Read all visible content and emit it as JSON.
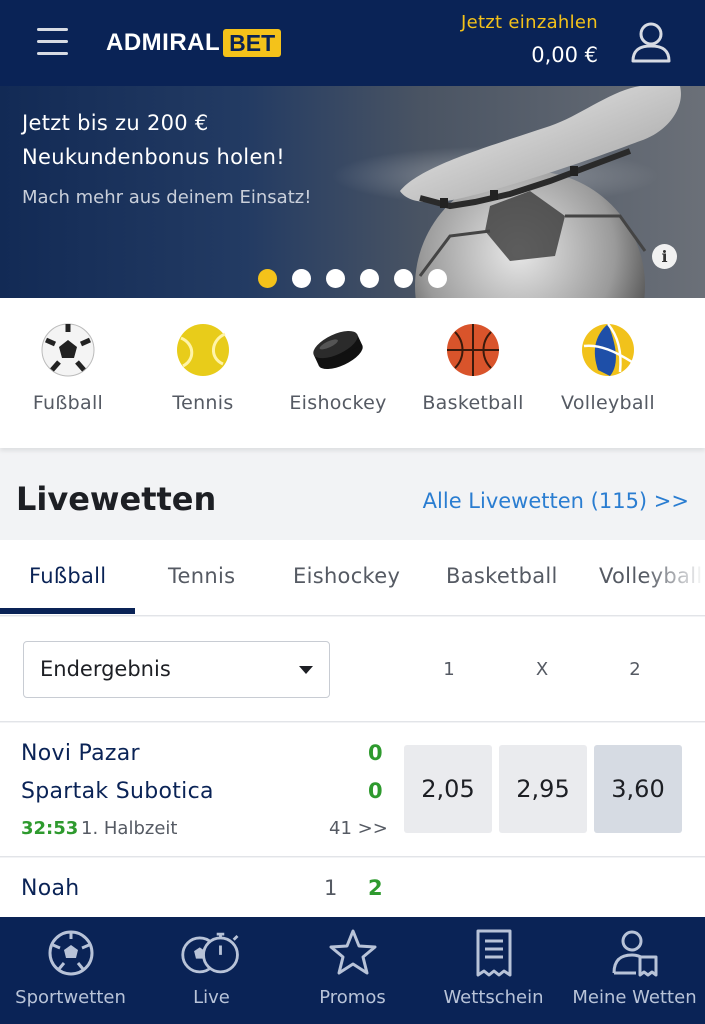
{
  "header": {
    "logo_left": "ADMIRAL",
    "logo_right": "BET",
    "deposit_label": "Jetzt einzahlen",
    "balance": "0,00 €"
  },
  "banner": {
    "headline_line1": "Jetzt bis zu 200 €",
    "headline_line2": "Neukundenbonus holen!",
    "subline": "Mach mehr aus deinem Einsatz!",
    "info_symbol": "i",
    "slides_total": 6,
    "active_slide": 1
  },
  "sports": [
    {
      "name": "Fußball",
      "icon": "soccer-ball-icon"
    },
    {
      "name": "Tennis",
      "icon": "tennis-ball-icon"
    },
    {
      "name": "Eishockey",
      "icon": "hockey-puck-icon"
    },
    {
      "name": "Basketball",
      "icon": "basketball-icon"
    },
    {
      "name": "Volleyball",
      "icon": "volleyball-icon"
    }
  ],
  "livewetten": {
    "title": "Livewetten",
    "all_link": "Alle Livewetten (115) >>",
    "tabs": [
      "Fußball",
      "Tennis",
      "Eishockey",
      "Basketball",
      "Volleyball"
    ],
    "active_tab": "Fußball",
    "market_select": "Endergebnis",
    "col_1": "1",
    "col_x": "X",
    "col_2": "2"
  },
  "matches": [
    {
      "home": "Novi Pazar",
      "away": "Spartak Subotica",
      "home_score": "0",
      "away_score": "0",
      "clock": "32:53",
      "period": "1. Halbzeit",
      "more_markets": "41 >>",
      "odds": [
        "2,05",
        "2,95",
        "3,60"
      ]
    },
    {
      "home": "Noah",
      "set_count": "1",
      "home_score": "2"
    }
  ],
  "bottom_nav": [
    {
      "label": "Sportwetten",
      "icon": "soccer-ball-icon"
    },
    {
      "label": "Live",
      "icon": "stopwatch-icon"
    },
    {
      "label": "Promos",
      "icon": "star-icon"
    },
    {
      "label": "Wettschein",
      "icon": "receipt-icon"
    },
    {
      "label": "Meine Wetten",
      "icon": "user-bets-icon"
    }
  ],
  "colors": {
    "navy": "#0a2356",
    "gold": "#f4c21a",
    "link_blue": "#2a7dd1",
    "live_green": "#2e9a2e"
  }
}
